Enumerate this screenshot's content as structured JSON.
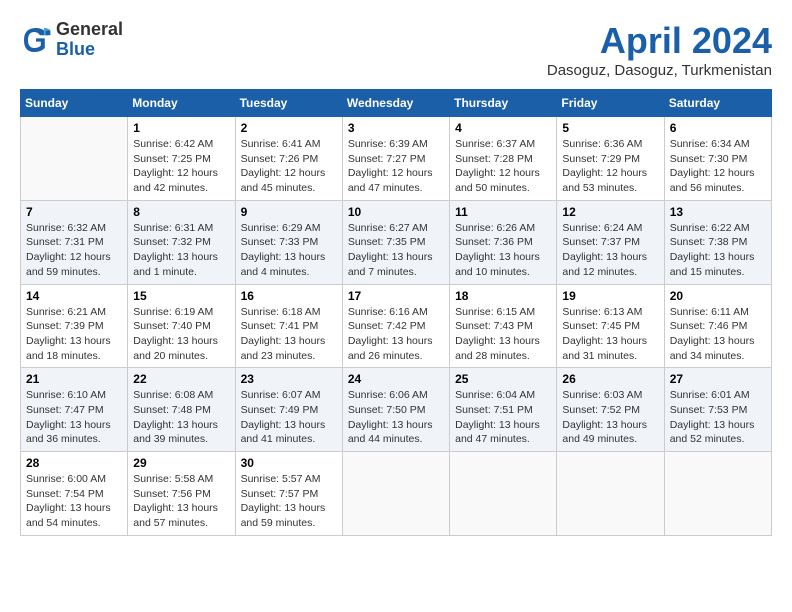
{
  "header": {
    "logo_general": "General",
    "logo_blue": "Blue",
    "month_title": "April 2024",
    "location": "Dasoguz, Dasoguz, Turkmenistan"
  },
  "calendar": {
    "days_of_week": [
      "Sunday",
      "Monday",
      "Tuesday",
      "Wednesday",
      "Thursday",
      "Friday",
      "Saturday"
    ],
    "weeks": [
      [
        {
          "day": "",
          "sunrise": "",
          "sunset": "",
          "daylight": ""
        },
        {
          "day": "1",
          "sunrise": "Sunrise: 6:42 AM",
          "sunset": "Sunset: 7:25 PM",
          "daylight": "Daylight: 12 hours and 42 minutes."
        },
        {
          "day": "2",
          "sunrise": "Sunrise: 6:41 AM",
          "sunset": "Sunset: 7:26 PM",
          "daylight": "Daylight: 12 hours and 45 minutes."
        },
        {
          "day": "3",
          "sunrise": "Sunrise: 6:39 AM",
          "sunset": "Sunset: 7:27 PM",
          "daylight": "Daylight: 12 hours and 47 minutes."
        },
        {
          "day": "4",
          "sunrise": "Sunrise: 6:37 AM",
          "sunset": "Sunset: 7:28 PM",
          "daylight": "Daylight: 12 hours and 50 minutes."
        },
        {
          "day": "5",
          "sunrise": "Sunrise: 6:36 AM",
          "sunset": "Sunset: 7:29 PM",
          "daylight": "Daylight: 12 hours and 53 minutes."
        },
        {
          "day": "6",
          "sunrise": "Sunrise: 6:34 AM",
          "sunset": "Sunset: 7:30 PM",
          "daylight": "Daylight: 12 hours and 56 minutes."
        }
      ],
      [
        {
          "day": "7",
          "sunrise": "Sunrise: 6:32 AM",
          "sunset": "Sunset: 7:31 PM",
          "daylight": "Daylight: 12 hours and 59 minutes."
        },
        {
          "day": "8",
          "sunrise": "Sunrise: 6:31 AM",
          "sunset": "Sunset: 7:32 PM",
          "daylight": "Daylight: 13 hours and 1 minute."
        },
        {
          "day": "9",
          "sunrise": "Sunrise: 6:29 AM",
          "sunset": "Sunset: 7:33 PM",
          "daylight": "Daylight: 13 hours and 4 minutes."
        },
        {
          "day": "10",
          "sunrise": "Sunrise: 6:27 AM",
          "sunset": "Sunset: 7:35 PM",
          "daylight": "Daylight: 13 hours and 7 minutes."
        },
        {
          "day": "11",
          "sunrise": "Sunrise: 6:26 AM",
          "sunset": "Sunset: 7:36 PM",
          "daylight": "Daylight: 13 hours and 10 minutes."
        },
        {
          "day": "12",
          "sunrise": "Sunrise: 6:24 AM",
          "sunset": "Sunset: 7:37 PM",
          "daylight": "Daylight: 13 hours and 12 minutes."
        },
        {
          "day": "13",
          "sunrise": "Sunrise: 6:22 AM",
          "sunset": "Sunset: 7:38 PM",
          "daylight": "Daylight: 13 hours and 15 minutes."
        }
      ],
      [
        {
          "day": "14",
          "sunrise": "Sunrise: 6:21 AM",
          "sunset": "Sunset: 7:39 PM",
          "daylight": "Daylight: 13 hours and 18 minutes."
        },
        {
          "day": "15",
          "sunrise": "Sunrise: 6:19 AM",
          "sunset": "Sunset: 7:40 PM",
          "daylight": "Daylight: 13 hours and 20 minutes."
        },
        {
          "day": "16",
          "sunrise": "Sunrise: 6:18 AM",
          "sunset": "Sunset: 7:41 PM",
          "daylight": "Daylight: 13 hours and 23 minutes."
        },
        {
          "day": "17",
          "sunrise": "Sunrise: 6:16 AM",
          "sunset": "Sunset: 7:42 PM",
          "daylight": "Daylight: 13 hours and 26 minutes."
        },
        {
          "day": "18",
          "sunrise": "Sunrise: 6:15 AM",
          "sunset": "Sunset: 7:43 PM",
          "daylight": "Daylight: 13 hours and 28 minutes."
        },
        {
          "day": "19",
          "sunrise": "Sunrise: 6:13 AM",
          "sunset": "Sunset: 7:45 PM",
          "daylight": "Daylight: 13 hours and 31 minutes."
        },
        {
          "day": "20",
          "sunrise": "Sunrise: 6:11 AM",
          "sunset": "Sunset: 7:46 PM",
          "daylight": "Daylight: 13 hours and 34 minutes."
        }
      ],
      [
        {
          "day": "21",
          "sunrise": "Sunrise: 6:10 AM",
          "sunset": "Sunset: 7:47 PM",
          "daylight": "Daylight: 13 hours and 36 minutes."
        },
        {
          "day": "22",
          "sunrise": "Sunrise: 6:08 AM",
          "sunset": "Sunset: 7:48 PM",
          "daylight": "Daylight: 13 hours and 39 minutes."
        },
        {
          "day": "23",
          "sunrise": "Sunrise: 6:07 AM",
          "sunset": "Sunset: 7:49 PM",
          "daylight": "Daylight: 13 hours and 41 minutes."
        },
        {
          "day": "24",
          "sunrise": "Sunrise: 6:06 AM",
          "sunset": "Sunset: 7:50 PM",
          "daylight": "Daylight: 13 hours and 44 minutes."
        },
        {
          "day": "25",
          "sunrise": "Sunrise: 6:04 AM",
          "sunset": "Sunset: 7:51 PM",
          "daylight": "Daylight: 13 hours and 47 minutes."
        },
        {
          "day": "26",
          "sunrise": "Sunrise: 6:03 AM",
          "sunset": "Sunset: 7:52 PM",
          "daylight": "Daylight: 13 hours and 49 minutes."
        },
        {
          "day": "27",
          "sunrise": "Sunrise: 6:01 AM",
          "sunset": "Sunset: 7:53 PM",
          "daylight": "Daylight: 13 hours and 52 minutes."
        }
      ],
      [
        {
          "day": "28",
          "sunrise": "Sunrise: 6:00 AM",
          "sunset": "Sunset: 7:54 PM",
          "daylight": "Daylight: 13 hours and 54 minutes."
        },
        {
          "day": "29",
          "sunrise": "Sunrise: 5:58 AM",
          "sunset": "Sunset: 7:56 PM",
          "daylight": "Daylight: 13 hours and 57 minutes."
        },
        {
          "day": "30",
          "sunrise": "Sunrise: 5:57 AM",
          "sunset": "Sunset: 7:57 PM",
          "daylight": "Daylight: 13 hours and 59 minutes."
        },
        {
          "day": "",
          "sunrise": "",
          "sunset": "",
          "daylight": ""
        },
        {
          "day": "",
          "sunrise": "",
          "sunset": "",
          "daylight": ""
        },
        {
          "day": "",
          "sunrise": "",
          "sunset": "",
          "daylight": ""
        },
        {
          "day": "",
          "sunrise": "",
          "sunset": "",
          "daylight": ""
        }
      ]
    ]
  }
}
